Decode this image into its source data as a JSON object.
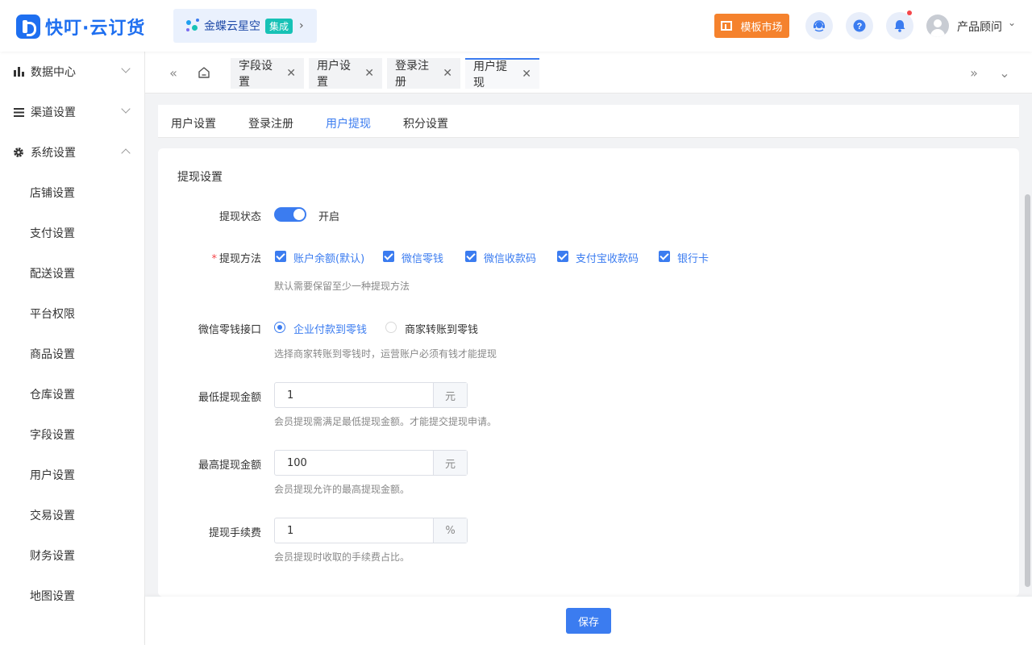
{
  "header": {
    "logo_text": "快叮·云订货",
    "brand": {
      "name": "金蝶云星空",
      "badge": "集成"
    },
    "market_label": "模板市场",
    "user_name": "产品顾问"
  },
  "sidebar": {
    "groups": [
      {
        "label": "数据中心",
        "icon": "bar-chart-icon",
        "expanded": false
      },
      {
        "label": "渠道设置",
        "icon": "list-icon",
        "expanded": false
      },
      {
        "label": "系统设置",
        "icon": "gear-icon",
        "expanded": true
      }
    ],
    "items": [
      "店铺设置",
      "支付设置",
      "配送设置",
      "平台权限",
      "商品设置",
      "仓库设置",
      "字段设置",
      "用户设置",
      "交易设置",
      "财务设置",
      "地图设置"
    ]
  },
  "page_tabs": [
    {
      "label": "字段设置",
      "active": false
    },
    {
      "label": "用户设置",
      "active": false
    },
    {
      "label": "登录注册",
      "active": false
    },
    {
      "label": "用户提现",
      "active": true
    }
  ],
  "sub_tabs": [
    {
      "label": "用户设置",
      "active": false
    },
    {
      "label": "登录注册",
      "active": false
    },
    {
      "label": "用户提现",
      "active": true
    },
    {
      "label": "积分设置",
      "active": false
    }
  ],
  "form": {
    "title": "提现设置",
    "status": {
      "label": "提现状态",
      "value": "开启",
      "enabled": true
    },
    "methods": {
      "label": "提现方法",
      "options": [
        "账户余额(默认)",
        "微信零钱",
        "微信收款码",
        "支付宝收款码",
        "银行卡"
      ],
      "hint": "默认需要保留至少一种提现方法"
    },
    "wechat_api": {
      "label": "微信零钱接口",
      "options": [
        "企业付款到零钱",
        "商家转账到零钱"
      ],
      "selected": "企业付款到零钱",
      "hint": "选择商家转账到零钱时，运营账户必须有钱才能提现"
    },
    "min_amount": {
      "label": "最低提现金额",
      "value": "1",
      "unit": "元",
      "hint": "会员提现需满足最低提现金额。才能提交提现申请。"
    },
    "max_amount": {
      "label": "最高提现金额",
      "value": "100",
      "unit": "元",
      "hint": "会员提现允许的最高提现金额。"
    },
    "fee": {
      "label": "提现手续费",
      "value": "1",
      "unit": "%",
      "hint": "会员提现时收取的手续费占比。"
    }
  },
  "footer": {
    "save_label": "保存"
  },
  "colors": {
    "primary": "#3b7cf0",
    "orange": "#f5822d",
    "teal": "#17c2b6",
    "danger": "#f5464a"
  }
}
